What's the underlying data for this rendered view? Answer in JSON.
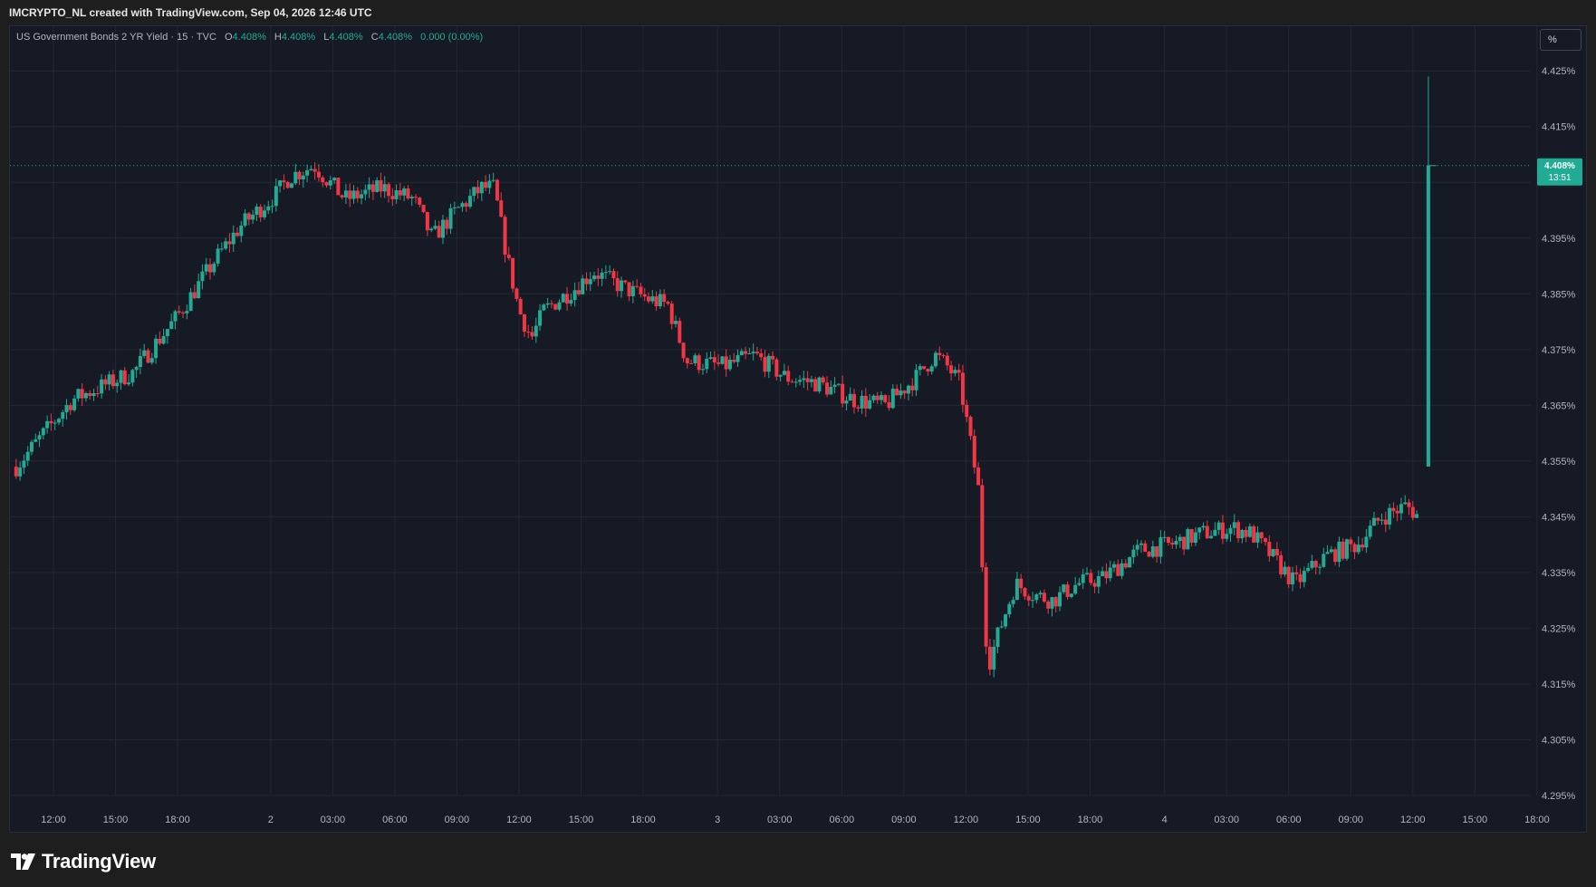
{
  "header": {
    "credit": "IMCRYPTO_NL created with TradingView.com, Sep 04, 2026 12:46 UTC"
  },
  "legend": {
    "symbol": "US Government Bonds 2 YR Yield · 15 · TVC",
    "o_label": "O",
    "o_value": "4.408%",
    "h_label": "H",
    "h_value": "4.408%",
    "l_label": "L",
    "l_value": "4.408%",
    "c_label": "C",
    "c_value": "4.408%",
    "change": "0.000 (0.00%)"
  },
  "unit_button": "%",
  "last_price": {
    "value_label": "4.408%",
    "countdown": "13:51"
  },
  "brand": {
    "name": "TradingView"
  },
  "colors": {
    "up": "#22ab94",
    "down": "#f23645",
    "background": "#161a25",
    "grid": "#232733",
    "axis_text": "#b2b5be"
  },
  "chart_data": {
    "type": "candlestick",
    "timeframe": "15",
    "ylim": [
      4.295,
      4.433
    ],
    "yticks": [
      4.425,
      4.415,
      4.405,
      4.395,
      4.385,
      4.375,
      4.365,
      4.355,
      4.345,
      4.335,
      4.325,
      4.315,
      4.305,
      4.295
    ],
    "ytick_labels": [
      "4.425%",
      "4.415%",
      "",
      "4.395%",
      "4.385%",
      "4.375%",
      "4.365%",
      "4.355%",
      "4.345%",
      "4.335%",
      "4.325%",
      "4.315%",
      "4.305%",
      "4.295%"
    ],
    "xlim": [
      -0.7,
      23.8
    ],
    "xticks": [
      {
        "x": 0,
        "label": "12:00"
      },
      {
        "x": 1,
        "label": "15:00"
      },
      {
        "x": 2,
        "label": "18:00"
      },
      {
        "x": 3.5,
        "label": "2"
      },
      {
        "x": 4.5,
        "label": "03:00"
      },
      {
        "x": 5.5,
        "label": "06:00"
      },
      {
        "x": 6.5,
        "label": "09:00"
      },
      {
        "x": 7.5,
        "label": "12:00"
      },
      {
        "x": 8.5,
        "label": "15:00"
      },
      {
        "x": 9.5,
        "label": "18:00"
      },
      {
        "x": 10.7,
        "label": "3"
      },
      {
        "x": 11.7,
        "label": "03:00"
      },
      {
        "x": 12.7,
        "label": "06:00"
      },
      {
        "x": 13.7,
        "label": "09:00"
      },
      {
        "x": 14.7,
        "label": "12:00"
      },
      {
        "x": 15.7,
        "label": "15:00"
      },
      {
        "x": 16.7,
        "label": "18:00"
      },
      {
        "x": 17.9,
        "label": "4"
      },
      {
        "x": 18.9,
        "label": "03:00"
      },
      {
        "x": 19.9,
        "label": "06:00"
      },
      {
        "x": 20.9,
        "label": "09:00"
      },
      {
        "x": 21.9,
        "label": "12:00"
      },
      {
        "x": 22.9,
        "label": "15:00"
      },
      {
        "x": 23.9,
        "label": "18:00"
      }
    ],
    "last_price": 4.408,
    "anchors": [
      [
        -0.6,
        4.354
      ],
      [
        0.3,
        4.366
      ],
      [
        0.7,
        4.368
      ],
      [
        1.3,
        4.371
      ],
      [
        1.5,
        4.374
      ],
      [
        2.0,
        4.381
      ],
      [
        2.6,
        4.391
      ],
      [
        3.0,
        4.397
      ],
      [
        3.6,
        4.403
      ],
      [
        3.8,
        4.406
      ],
      [
        4.2,
        4.408
      ],
      [
        4.7,
        4.402
      ],
      [
        5.3,
        4.404
      ],
      [
        5.8,
        4.402
      ],
      [
        6.1,
        4.395
      ],
      [
        6.5,
        4.4
      ],
      [
        6.9,
        4.404
      ],
      [
        7.1,
        4.404
      ],
      [
        7.3,
        4.392
      ],
      [
        7.5,
        4.382
      ],
      [
        7.7,
        4.377
      ],
      [
        7.9,
        4.382
      ],
      [
        8.4,
        4.386
      ],
      [
        8.7,
        4.389
      ],
      [
        9.2,
        4.386
      ],
      [
        9.6,
        4.384
      ],
      [
        9.9,
        4.383
      ],
      [
        10.2,
        4.373
      ],
      [
        10.8,
        4.372
      ],
      [
        11.3,
        4.374
      ],
      [
        11.8,
        4.37
      ],
      [
        12.3,
        4.369
      ],
      [
        12.9,
        4.366
      ],
      [
        13.4,
        4.365
      ],
      [
        13.9,
        4.37
      ],
      [
        14.2,
        4.374
      ],
      [
        14.4,
        4.372
      ],
      [
        14.6,
        4.369
      ],
      [
        14.7,
        4.363
      ],
      [
        14.9,
        4.35
      ],
      [
        15.05,
        4.318
      ],
      [
        15.25,
        4.325
      ],
      [
        15.5,
        4.333
      ],
      [
        15.8,
        4.331
      ],
      [
        16.1,
        4.33
      ],
      [
        16.5,
        4.333
      ],
      [
        16.9,
        4.334
      ],
      [
        17.5,
        4.339
      ],
      [
        18.0,
        4.34
      ],
      [
        18.5,
        4.342
      ],
      [
        19.0,
        4.343
      ],
      [
        19.3,
        4.342
      ],
      [
        19.7,
        4.337
      ],
      [
        20.0,
        4.333
      ],
      [
        20.5,
        4.338
      ],
      [
        21.0,
        4.34
      ],
      [
        21.4,
        4.345
      ],
      [
        21.8,
        4.347
      ],
      [
        22.0,
        4.345
      ]
    ],
    "final_candle": {
      "x": 22.15,
      "open": 4.354,
      "high": 4.424,
      "low": 4.354,
      "close": 4.408
    }
  }
}
